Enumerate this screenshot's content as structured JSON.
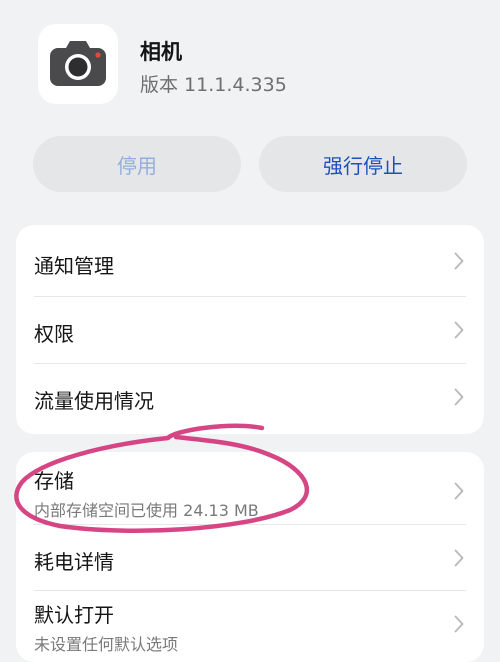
{
  "app": {
    "name": "相机",
    "version": "版本 11.1.4.335"
  },
  "buttons": {
    "disable": "停用",
    "force_stop": "强行停止"
  },
  "group1": [
    {
      "title": "通知管理"
    },
    {
      "title": "权限"
    },
    {
      "title": "流量使用情况"
    }
  ],
  "group2": [
    {
      "title": "存储",
      "subtitle": "内部存储空间已使用 24.13 MB"
    },
    {
      "title": "耗电详情"
    },
    {
      "title": "默认打开",
      "subtitle": "未设置任何默认选项"
    }
  ],
  "colors": {
    "page_background": "#f1f2f4",
    "card_background": "#ffffff",
    "button_background": "#e5e6e8",
    "disabled_button_text": "#93aede",
    "accent_blue": "#1c4fbf",
    "annotation_stroke": "#d2357a"
  },
  "icons": {
    "app": "camera-icon",
    "chevron": "chevron-right-icon"
  }
}
